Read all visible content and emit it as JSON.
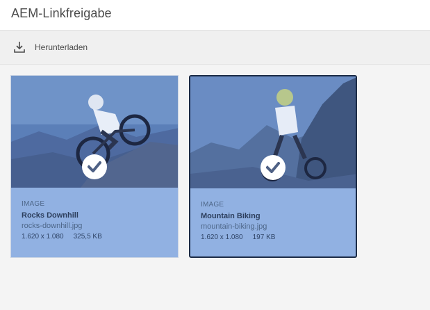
{
  "header": {
    "title": "AEM-Linkfreigabe"
  },
  "toolbar": {
    "download_label": "Herunterladen",
    "download_icon": "download-icon"
  },
  "assets": [
    {
      "type": "IMAGE",
      "title": "Rocks Downhill",
      "filename": "rocks-downhill.jpg",
      "dimensions": "1.620 x 1.080",
      "size": "325,5 KB",
      "selected": true
    },
    {
      "type": "IMAGE",
      "title": "Mountain Biking",
      "filename": "mountain-biking.jpg",
      "dimensions": "1.620 x 1.080",
      "size": "197 KB",
      "selected": true
    }
  ],
  "colors": {
    "card_overlay": "#91b1e2",
    "focus_border": "#1c2b45",
    "check_mark": "#4f6185"
  }
}
